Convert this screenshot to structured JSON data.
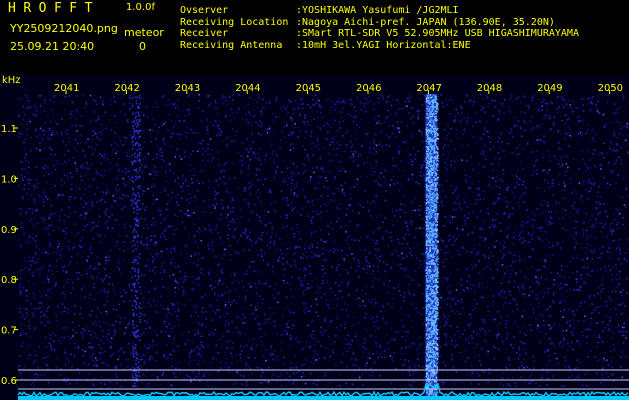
{
  "header": {
    "app_title": "HROFFT",
    "version": "1.0.0f",
    "filename": "YY2509212040.png",
    "datetime": "25.09.21 20:40",
    "meteor_label": "meteor",
    "meteor_count": "0",
    "info": [
      {
        "label": "Ovserver",
        "value": ":YOSHIKAWA Yasufumi /JG2MLI"
      },
      {
        "label": "Receiving Location",
        "value": ":Nagoya Aichi-pref. JAPAN (136.90E, 35.20N)"
      },
      {
        "label": "Receiver",
        "value": ":SMart RTL-SDR V5 52.905MHz USB HIGASHIMURAYAMA"
      },
      {
        "label": "Receiving Antenna",
        "value": ":10mH 3el.YAGI Horizontal:ENE"
      }
    ]
  },
  "colors": {
    "text": "#ffff00",
    "background": "#000000",
    "noise": "#1c1cb0",
    "signal": "#4aa0ff",
    "spectrum": "#00c8ff"
  },
  "chart_data": {
    "type": "heatmap",
    "ylabel": "kHz",
    "x_ticks": [
      "2041",
      "2042",
      "2043",
      "2044",
      "2045",
      "2046",
      "2047",
      "2048",
      "2049",
      "2050"
    ],
    "y_ticks": [
      "1.1",
      "1.0",
      "0.9",
      "0.8",
      "0.7",
      "0.6"
    ],
    "ylim": [
      0.58,
      1.17
    ],
    "xlim": [
      2040.6,
      2050.2
    ],
    "signal_column": 2047.05
  }
}
